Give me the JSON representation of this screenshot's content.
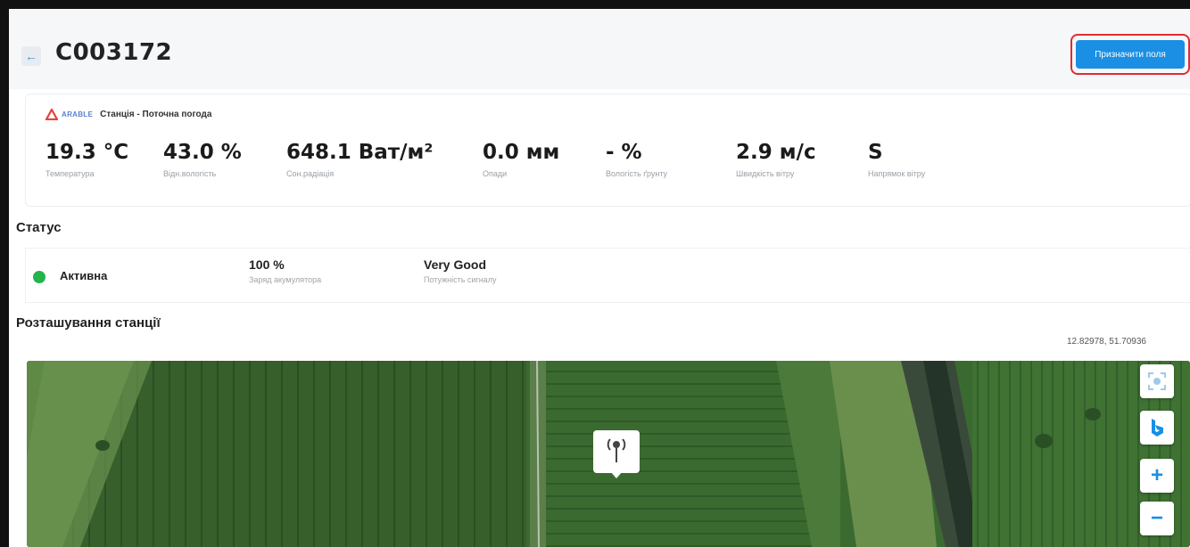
{
  "header": {
    "back_icon": "arrow-left-icon",
    "title": "C003172",
    "assign_button": "Призначити поля"
  },
  "weather": {
    "brand": "ARABLE",
    "title": "Станція - Поточна погода",
    "metrics": [
      {
        "value": "19.3 °C",
        "label": "Температура"
      },
      {
        "value": "43.0 %",
        "label": "Відн.вологість"
      },
      {
        "value": "648.1 Ват/м²",
        "label": "Сон.радіація"
      },
      {
        "value": "0.0 мм",
        "label": "Опади"
      },
      {
        "value": "- %",
        "label": "Вологість ґрунту"
      },
      {
        "value": "2.9 м/с",
        "label": "Швидкість вітру"
      },
      {
        "value": "S",
        "label": "Напрямок вітру"
      }
    ]
  },
  "status": {
    "section_title": "Статус",
    "state": "Активна",
    "battery_value": "100 %",
    "battery_label": "Заряд акумулятора",
    "signal_value": "Very Good",
    "signal_label": "Потужність сигналу",
    "colors": {
      "active": "#25b34b"
    }
  },
  "location": {
    "section_title": "Розташування станції",
    "coords": "12.82978, 51.70936",
    "controls": {
      "locate_icon": "locate-icon",
      "bing_icon": "bing-icon",
      "zoom_in": "+",
      "zoom_out": "−"
    },
    "marker_icon": "antenna-icon"
  },
  "colors": {
    "accent": "#1a8fe3",
    "highlight": "#e02b36"
  }
}
